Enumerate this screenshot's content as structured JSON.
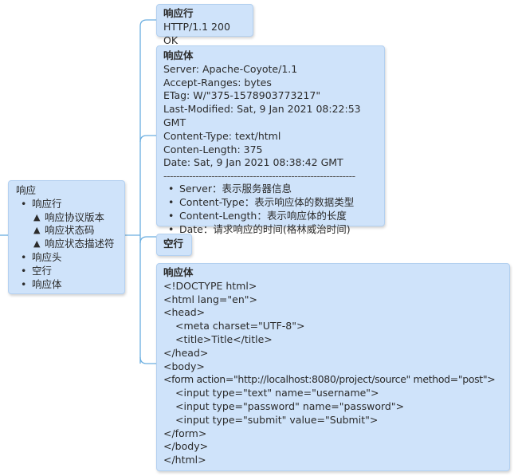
{
  "root": {
    "title": "响应",
    "items": [
      {
        "label": "响应行",
        "children": [
          "响应协议版本",
          "响应状态码",
          "响应状态描述符"
        ]
      },
      {
        "label": "响应头",
        "children": []
      },
      {
        "label": "空行",
        "children": []
      },
      {
        "label": "响应体",
        "children": []
      }
    ]
  },
  "line_node": {
    "title": "响应行",
    "text": "HTTP/1.1 200 OK"
  },
  "header_node": {
    "title": "响应体",
    "lines": [
      "Server: Apache-Coyote/1.1",
      "Accept-Ranges: bytes",
      "ETag: W/\"375-1578903773217\"",
      "Last-Modified: Sat, 9 Jan 2021 08:22:53 GMT",
      "Content-Type: text/html",
      "Conten-Length: 375",
      "Date: Sat, 9 Jan 2021 08:38:42 GMT"
    ],
    "separator": "------------------------------------------------------------",
    "notes": [
      "Server：表示服务器信息",
      "Content-Type：表示响应体的数据类型",
      "Content-Length：表示响应体的长度",
      "Date：请求响应的时间(格林威治时间)"
    ]
  },
  "blank_node": {
    "title": "空行"
  },
  "body_node": {
    "title": "响应体",
    "lines": [
      {
        "text": "<!DOCTYPE html>",
        "indent": 0
      },
      {
        "text": "<html lang=\"en\">",
        "indent": 0
      },
      {
        "text": "<head>",
        "indent": 0
      },
      {
        "text": "<meta charset=\"UTF-8\">",
        "indent": 1
      },
      {
        "text": "<title>Title</title>",
        "indent": 1
      },
      {
        "text": "</head>",
        "indent": 0
      },
      {
        "text": "<body>",
        "indent": 0
      },
      {
        "text": "<form action=\"http://localhost:8080/project/source\" method=\"post\">",
        "indent": 0
      },
      {
        "text": "<input type=\"text\" name=\"username\">",
        "indent": 1
      },
      {
        "text": "<input type=\"password\" name=\"password\">",
        "indent": 1
      },
      {
        "text": "<input type=\"submit\" value=\"Submit\">",
        "indent": 1
      },
      {
        "text": "</form>",
        "indent": 0
      },
      {
        "text": "</body>",
        "indent": 0
      },
      {
        "text": "</html>",
        "indent": 0
      }
    ]
  },
  "colors": {
    "node_fill": "#cfe3fa",
    "node_border": "#b3d0f0",
    "connector": "#6aaee0"
  }
}
